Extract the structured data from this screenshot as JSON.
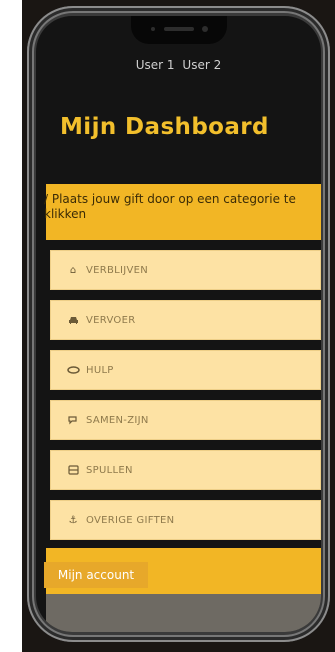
{
  "header": {
    "users": [
      "User 1",
      "User 2"
    ]
  },
  "dashboard": {
    "title": "Mijn Dashboard"
  },
  "banner": {
    "text": "/ Plaats jouw gift door op een categorie te klikken"
  },
  "menu": {
    "items": [
      {
        "label": "VERBLIJVEN",
        "icon": "home-icon",
        "glyph": "🏠"
      },
      {
        "label": "VERVOER",
        "icon": "car-icon",
        "glyph": "🚗"
      },
      {
        "label": "HULP",
        "icon": "handshake-icon",
        "glyph": "⇄"
      },
      {
        "label": "SAMEN-ZIJN",
        "icon": "chat-icon",
        "glyph": "💬"
      },
      {
        "label": "SPULLEN",
        "icon": "box-icon",
        "glyph": "▤"
      },
      {
        "label": "OVERIGE GIFTEN",
        "icon": "anchor-icon",
        "glyph": "⚓"
      }
    ]
  },
  "account": {
    "label": "Mijn account"
  },
  "colors": {
    "accent": "#f2b625",
    "menu_bg": "#fde2a4",
    "title": "#f2bf2c"
  }
}
